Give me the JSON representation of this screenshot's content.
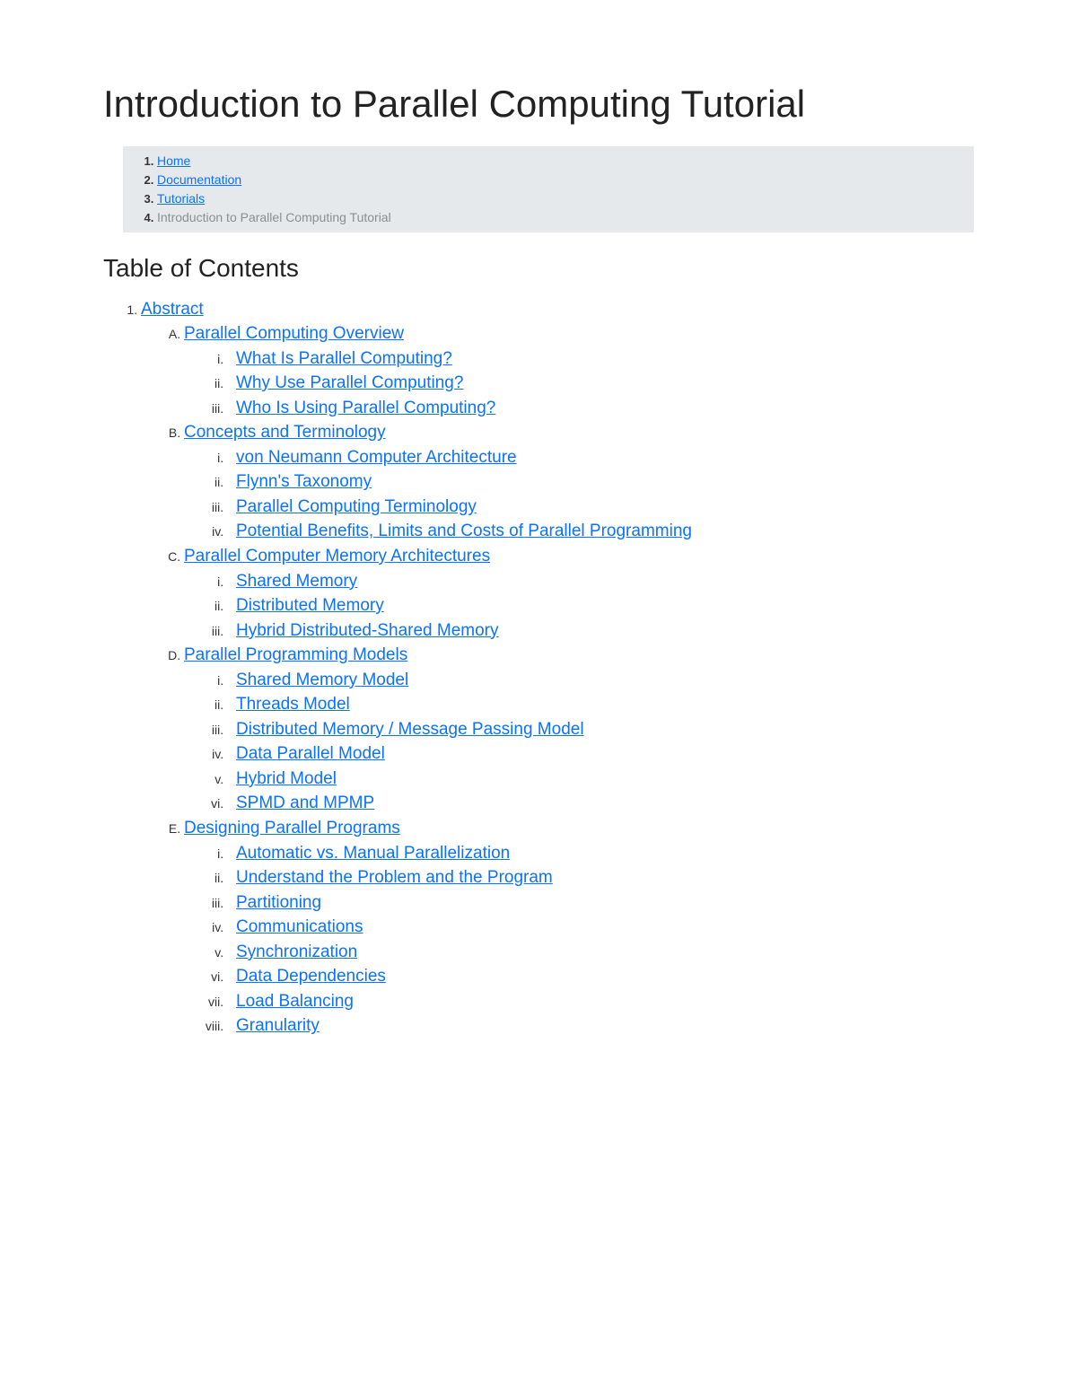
{
  "title": "Introduction to Parallel Computing Tutorial",
  "breadcrumb": [
    {
      "label": "Home",
      "link": true
    },
    {
      "label": "Documentation",
      "link": true
    },
    {
      "label": "Tutorials",
      "link": true
    },
    {
      "label": "Introduction to Parallel Computing Tutorial",
      "link": false
    }
  ],
  "toc_heading": "Table of Contents",
  "toc": {
    "root": "Abstract",
    "sections": [
      {
        "title": "Parallel Computing Overview",
        "items": [
          "What Is Parallel Computing?",
          "Why Use Parallel Computing?",
          "Who Is Using Parallel Computing?"
        ]
      },
      {
        "title": "Concepts and Terminology",
        "items": [
          "von Neumann Computer Architecture",
          "Flynn's Taxonomy",
          "Parallel Computing Terminology",
          "Potential Benefits, Limits and Costs of Parallel Programming"
        ]
      },
      {
        "title": "Parallel Computer Memory Architectures",
        "items": [
          "Shared Memory",
          "Distributed Memory",
          "Hybrid Distributed-Shared Memory"
        ]
      },
      {
        "title": "Parallel Programming Models",
        "items": [
          "Shared Memory Model",
          "Threads Model",
          "Distributed Memory / Message Passing Model",
          "Data Parallel Model",
          "Hybrid Model",
          "SPMD and MPMP"
        ]
      },
      {
        "title": "Designing Parallel Programs",
        "items": [
          "Automatic vs. Manual Parallelization",
          "Understand the Problem and the Program",
          "Partitioning",
          "Communications",
          "Synchronization",
          "Data Dependencies",
          "Load Balancing",
          "Granularity"
        ]
      }
    ]
  }
}
